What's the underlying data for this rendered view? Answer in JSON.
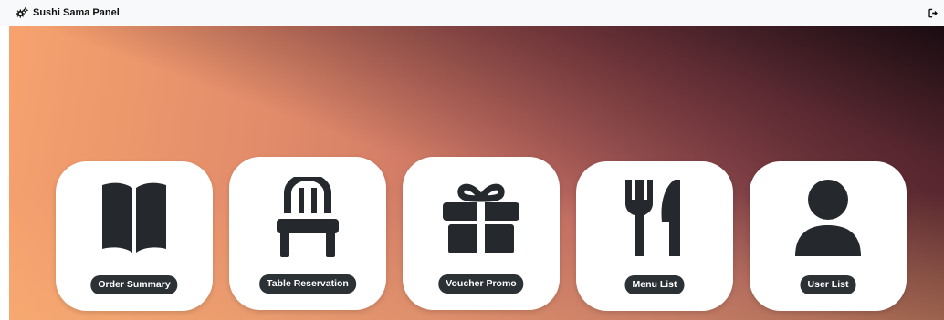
{
  "navbar": {
    "brand_label": "Sushi Sama Panel",
    "brand_icon": "gears-icon",
    "logout_icon": "logout-icon"
  },
  "menu": {
    "items": [
      {
        "label": "Order Summary",
        "icon": "book-open-icon"
      },
      {
        "label": "Table Reservation",
        "icon": "chair-icon"
      },
      {
        "label": "Voucher Promo",
        "icon": "gift-icon"
      },
      {
        "label": "Menu List",
        "icon": "utensils-icon"
      },
      {
        "label": "User List",
        "icon": "user-icon"
      }
    ]
  },
  "colors": {
    "card_background": "#ffffff",
    "icon_color": "#25292d",
    "pill_background": "#2c3135",
    "navbar_background": "#f8f9fa"
  }
}
